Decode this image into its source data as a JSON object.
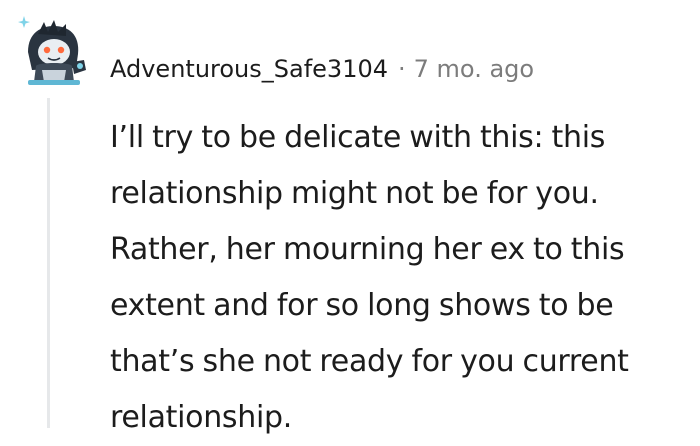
{
  "comment": {
    "author": "Adventurous_Safe3104",
    "separator": "·",
    "time_ago": "7 mo. ago",
    "avatar_icon": "snoo-avatar-icon",
    "body_lines": [
      "I’ll try to be delicate with this: this",
      "relationship might not be for you.",
      "Rather, her mourning her ex to this",
      "extent and for so long shows to be",
      "that’s she not ready for you current",
      "relationship."
    ]
  }
}
